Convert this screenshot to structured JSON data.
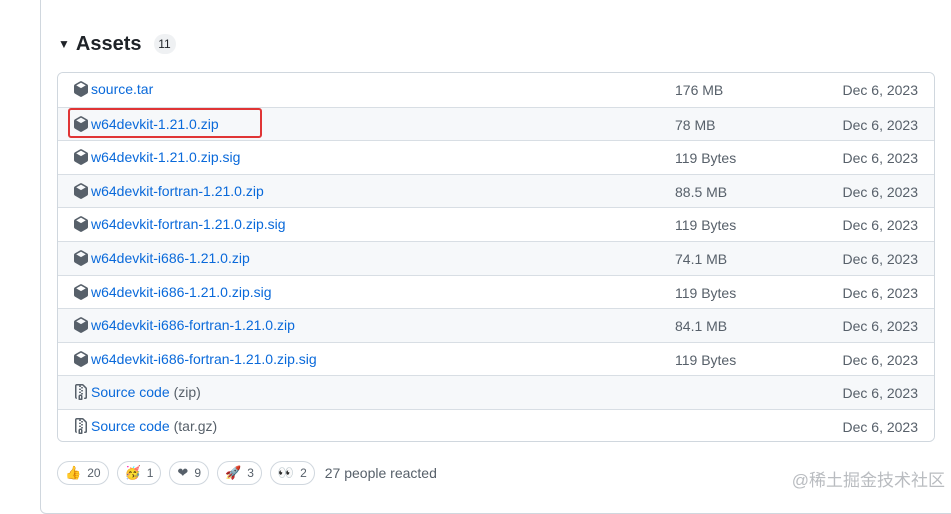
{
  "assets": {
    "title": "Assets",
    "count": "11",
    "items": [
      {
        "name": "source.tar",
        "suffix": "",
        "size": "176 MB",
        "date": "Dec 6, 2023",
        "icon": "package-icon"
      },
      {
        "name": "w64devkit-1.21.0.zip",
        "suffix": "",
        "size": "78 MB",
        "date": "Dec 6, 2023",
        "icon": "package-icon"
      },
      {
        "name": "w64devkit-1.21.0.zip.sig",
        "suffix": "",
        "size": "119 Bytes",
        "date": "Dec 6, 2023",
        "icon": "package-icon"
      },
      {
        "name": "w64devkit-fortran-1.21.0.zip",
        "suffix": "",
        "size": "88.5 MB",
        "date": "Dec 6, 2023",
        "icon": "package-icon"
      },
      {
        "name": "w64devkit-fortran-1.21.0.zip.sig",
        "suffix": "",
        "size": "119 Bytes",
        "date": "Dec 6, 2023",
        "icon": "package-icon"
      },
      {
        "name": "w64devkit-i686-1.21.0.zip",
        "suffix": "",
        "size": "74.1 MB",
        "date": "Dec 6, 2023",
        "icon": "package-icon"
      },
      {
        "name": "w64devkit-i686-1.21.0.zip.sig",
        "suffix": "",
        "size": "119 Bytes",
        "date": "Dec 6, 2023",
        "icon": "package-icon"
      },
      {
        "name": "w64devkit-i686-fortran-1.21.0.zip",
        "suffix": "",
        "size": "84.1 MB",
        "date": "Dec 6, 2023",
        "icon": "package-icon"
      },
      {
        "name": "w64devkit-i686-fortran-1.21.0.zip.sig",
        "suffix": "",
        "size": "119 Bytes",
        "date": "Dec 6, 2023",
        "icon": "package-icon"
      },
      {
        "name": "Source code",
        "suffix": "(zip)",
        "size": "",
        "date": "Dec 6, 2023",
        "icon": "file-zip-icon"
      },
      {
        "name": "Source code",
        "suffix": "(tar.gz)",
        "size": "",
        "date": "Dec 6, 2023",
        "icon": "file-zip-icon"
      }
    ]
  },
  "reactions": {
    "items": [
      {
        "emoji": "👍",
        "count": "20",
        "name": "thumbs-up-icon"
      },
      {
        "emoji": "🥳",
        "count": "1",
        "name": "party-icon"
      },
      {
        "emoji": "❤",
        "count": "9",
        "name": "heart-icon"
      },
      {
        "emoji": "🚀",
        "count": "3",
        "name": "rocket-icon"
      },
      {
        "emoji": "👀",
        "count": "2",
        "name": "eyes-icon"
      }
    ],
    "summary": "27 people reacted"
  },
  "watermark": "@稀土掘金技术社区",
  "colors": {
    "link": "#0969da",
    "muted": "#57606a",
    "highlight": "#e03535",
    "border": "#d0d7de"
  }
}
